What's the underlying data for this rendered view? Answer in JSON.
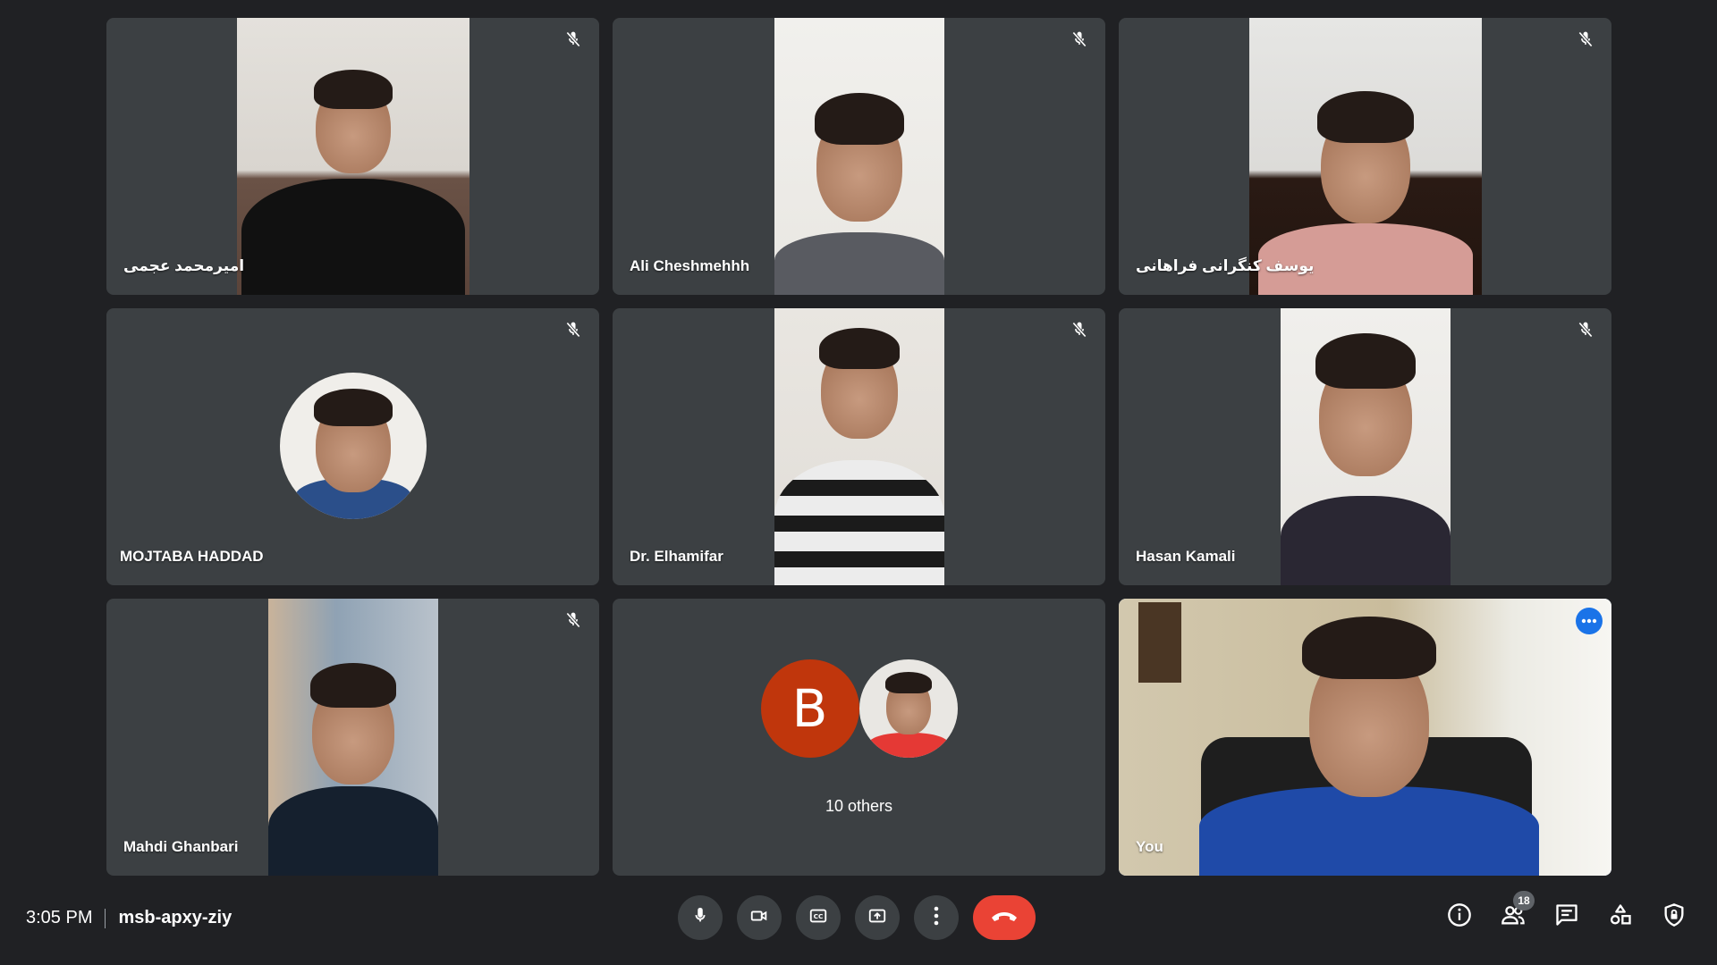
{
  "meeting": {
    "time": "3:05 PM",
    "code": "msb-apxy-ziy"
  },
  "participants": [
    {
      "name": "امیرمحمد عجمی",
      "muted": true,
      "rtl": true
    },
    {
      "name": "Ali Cheshmehhh",
      "muted": true
    },
    {
      "name": "یوسف کنگرانی فراهانی",
      "muted": true,
      "rtl": true
    },
    {
      "name": "MOJTABA HADDAD",
      "muted": true
    },
    {
      "name": "Dr. Elhamifar",
      "muted": true
    },
    {
      "name": "Hasan Kamali",
      "muted": true
    },
    {
      "name": "Mahdi Ghanbari",
      "muted": true
    }
  ],
  "others_tile": {
    "avatar_letter": "B",
    "label": "10 others"
  },
  "self_tile": {
    "name": "You"
  },
  "participant_count": "18",
  "colors": {
    "background": "#202124",
    "tile": "#3c4043",
    "accent": "#8ab4f8",
    "end_call": "#ea4335",
    "b_avatar": "#c0360c"
  },
  "controls": [
    "mic-icon",
    "camera-icon",
    "captions-icon",
    "present-icon",
    "more-options-icon",
    "end-call-icon"
  ],
  "right_icons": [
    "info-icon",
    "people-icon",
    "chat-icon",
    "activities-icon",
    "host-controls-icon"
  ]
}
